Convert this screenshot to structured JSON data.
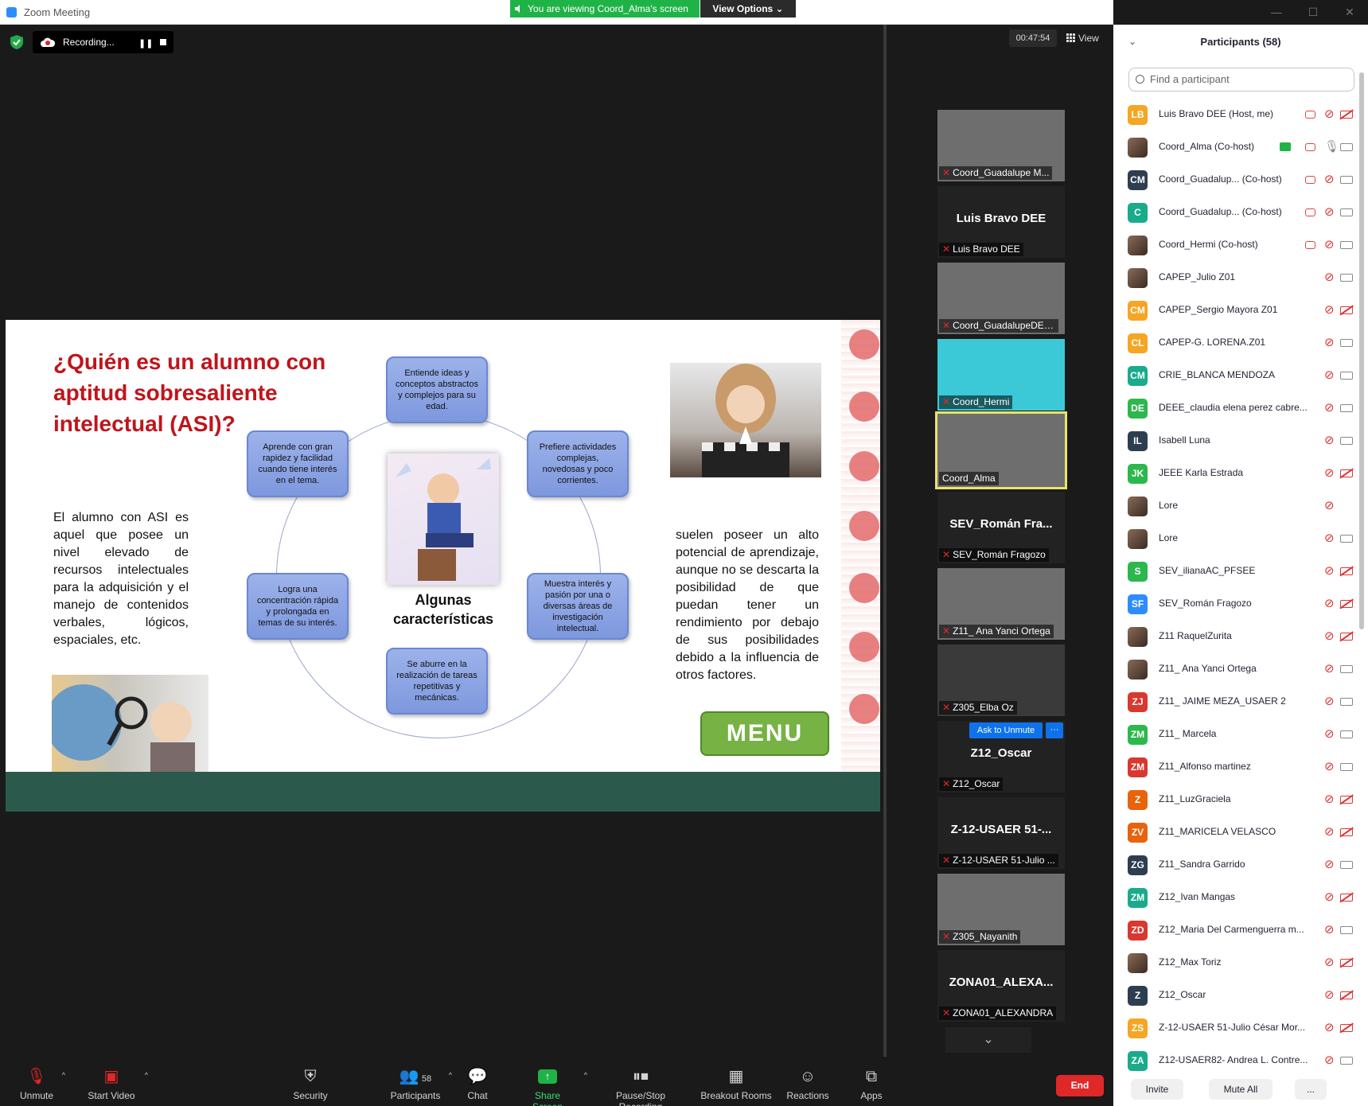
{
  "window": {
    "title": "Zoom Meeting",
    "controls": [
      "—",
      "☐",
      "✕"
    ]
  },
  "banner": {
    "text": "You are viewing Coord_Alma's screen",
    "view_options": "View Options ⌄"
  },
  "meeting": {
    "recording": "Recording...",
    "timer": "00:47:54",
    "view": "View"
  },
  "slide": {
    "title": "¿Quién es un alumno con aptitud sobresaliente intelectual (ASI)?",
    "left_text": "El alumno con ASI es aquel que posee un nivel elevado de recursos intelectuales para la adquisición y el manejo de contenidos verbales, lógicos, espaciales, etc.",
    "right_text": "suelen poseer un alto potencial de aprendizaje, aunque no se descarta la posibilidad de que puedan tener un rendimiento por debajo de sus posibilidades debido a la influencia de otros factores.",
    "center_label": "Algunas características",
    "nodes": [
      "Entiende ideas y conceptos abstractos y complejos para su edad.",
      "Prefiere actividades complejas, novedosas y poco corrientes.",
      "Muestra interés y pasión por una o diversas áreas de investigación intelectual.",
      "Se aburre en la realización de tareas repetitivas y mecánicas.",
      "Logra una concentración rápida y prolongada en temas de su interés.",
      "Aprende con gran rapidez y facilidad cuando tiene interés en el tema."
    ],
    "menu": "MENU"
  },
  "gallery": [
    {
      "name": "Coord_Guadalupe M...",
      "big": "",
      "video": true
    },
    {
      "name": "Luis Bravo DEE",
      "big": "Luis Bravo DEE",
      "video": false
    },
    {
      "name": "Coord_GuadalupeDEEE",
      "big": "",
      "video": true
    },
    {
      "name": "Coord_Hermi",
      "big": "",
      "video": true
    },
    {
      "name": "Coord_Alma",
      "big": "",
      "video": true
    },
    {
      "name": "SEV_Román Fragozo",
      "big": "SEV_Román Fra...",
      "video": false
    },
    {
      "name": "Z11_ Ana Yanci Ortega",
      "big": "",
      "video": true
    },
    {
      "name": "Z305_Elba Oz",
      "big": "",
      "video": true
    },
    {
      "name": "Z12_Oscar",
      "big": "Z12_Oscar",
      "video": false
    },
    {
      "name": "Z-12-USAER 51-Julio ...",
      "big": "Z-12-USAER 51-...",
      "video": false
    },
    {
      "name": "Z305_Nayanith",
      "big": "",
      "video": true
    },
    {
      "name": "ZONA01_ALEXANDRA",
      "big": "ZONA01_ALEXA...",
      "video": false
    }
  ],
  "gallery_actions": {
    "ask_unmute": "Ask to Unmute",
    "more": "···"
  },
  "toolbar": {
    "unmute": "Unmute",
    "start_video": "Start Video",
    "security": "Security",
    "participants": "Participants",
    "participants_count": "58",
    "chat": "Chat",
    "share_screen": "Share Screen",
    "pause_stop": "Pause/Stop Recording",
    "breakout": "Breakout Rooms",
    "reactions": "Reactions",
    "apps": "Apps",
    "end": "End"
  },
  "panel": {
    "title": "Participants (58)",
    "search_placeholder": "Find a participant",
    "invite": "Invite",
    "mute_all": "Mute All",
    "more": "...",
    "participants": [
      {
        "initials": "LB",
        "name": "Luis Bravo DEE (Host, me)",
        "color": "#f5a623",
        "rec": true,
        "cam": "off"
      },
      {
        "initials": "",
        "name": "Coord_Alma (Co-host)",
        "color": "photo",
        "rec": true,
        "share": true,
        "mic": "on",
        "cam": "on"
      },
      {
        "initials": "CM",
        "name": "Coord_Guadalup...  (Co-host)",
        "color": "#2d3e50",
        "rec": true,
        "cam": "on"
      },
      {
        "initials": "C",
        "name": "Coord_Guadalup...  (Co-host)",
        "color": "#1aab8b",
        "rec": true,
        "cam": "on"
      },
      {
        "initials": "",
        "name": "Coord_Hermi (Co-host)",
        "color": "photo",
        "rec": true,
        "cam": "on"
      },
      {
        "initials": "",
        "name": "CAPEP_Julio Z01",
        "color": "photo",
        "cam": "on"
      },
      {
        "initials": "CM",
        "name": "CAPEP_Sergio Mayora Z01",
        "color": "#f5a623",
        "cam": "off"
      },
      {
        "initials": "CL",
        "name": "CAPEP-G. LORENA.Z01",
        "color": "#f5a623",
        "cam": "on"
      },
      {
        "initials": "CM",
        "name": "CRIE_BLANCA MENDOZA",
        "color": "#1aab8b",
        "cam": "on"
      },
      {
        "initials": "DE",
        "name": "DEEE_claudia elena perez cabre...",
        "color": "#2db84d",
        "cam": "on"
      },
      {
        "initials": "IL",
        "name": "Isabell Luna",
        "color": "#2d3e50",
        "cam": "on"
      },
      {
        "initials": "JK",
        "name": "JEEE Karla Estrada",
        "color": "#2db84d",
        "cam": "off"
      },
      {
        "initials": "",
        "name": "Lore",
        "color": "photo",
        "cam": "none"
      },
      {
        "initials": "",
        "name": "Lore",
        "color": "photo",
        "cam": "on"
      },
      {
        "initials": "S",
        "name": "SEV_ilianaAC_PFSEE",
        "color": "#2db84d",
        "cam": "off"
      },
      {
        "initials": "SF",
        "name": "SEV_Román Fragozo",
        "color": "#2d8cff",
        "cam": "off"
      },
      {
        "initials": "",
        "name": "Z11 RaquelZurita",
        "color": "photo",
        "cam": "off"
      },
      {
        "initials": "",
        "name": "Z11_ Ana Yanci Ortega",
        "color": "photo",
        "cam": "on"
      },
      {
        "initials": "ZJ",
        "name": "Z11_ JAIME MEZA_USAER 2",
        "color": "#d9382f",
        "cam": "on"
      },
      {
        "initials": "ZM",
        "name": "Z11_ Marcela",
        "color": "#2db84d",
        "cam": "on"
      },
      {
        "initials": "ZM",
        "name": "Z11_Alfonso martinez",
        "color": "#d9382f",
        "cam": "on"
      },
      {
        "initials": "Z",
        "name": "Z11_LuzGraciela",
        "color": "#e8630a",
        "cam": "off"
      },
      {
        "initials": "ZV",
        "name": "Z11_MARICELA VELASCO",
        "color": "#e8630a",
        "cam": "off"
      },
      {
        "initials": "ZG",
        "name": "Z11_Sandra Garrido",
        "color": "#2d3e50",
        "cam": "on"
      },
      {
        "initials": "ZM",
        "name": "Z12_Ivan Mangas",
        "color": "#1aab8b",
        "cam": "off"
      },
      {
        "initials": "ZD",
        "name": "Z12_Maria Del Carmenguerra m...",
        "color": "#d9382f",
        "cam": "on"
      },
      {
        "initials": "",
        "name": "Z12_Max Toriz",
        "color": "photo",
        "cam": "off"
      },
      {
        "initials": "Z",
        "name": "Z12_Oscar",
        "color": "#2d3e50",
        "cam": "off"
      },
      {
        "initials": "ZS",
        "name": "Z-12-USAER 51-Julio César Mor...",
        "color": "#f5a623",
        "cam": "off"
      },
      {
        "initials": "ZA",
        "name": "Z12-USAER82- Andrea L. Contre...",
        "color": "#1aab8b",
        "cam": "on"
      }
    ]
  }
}
